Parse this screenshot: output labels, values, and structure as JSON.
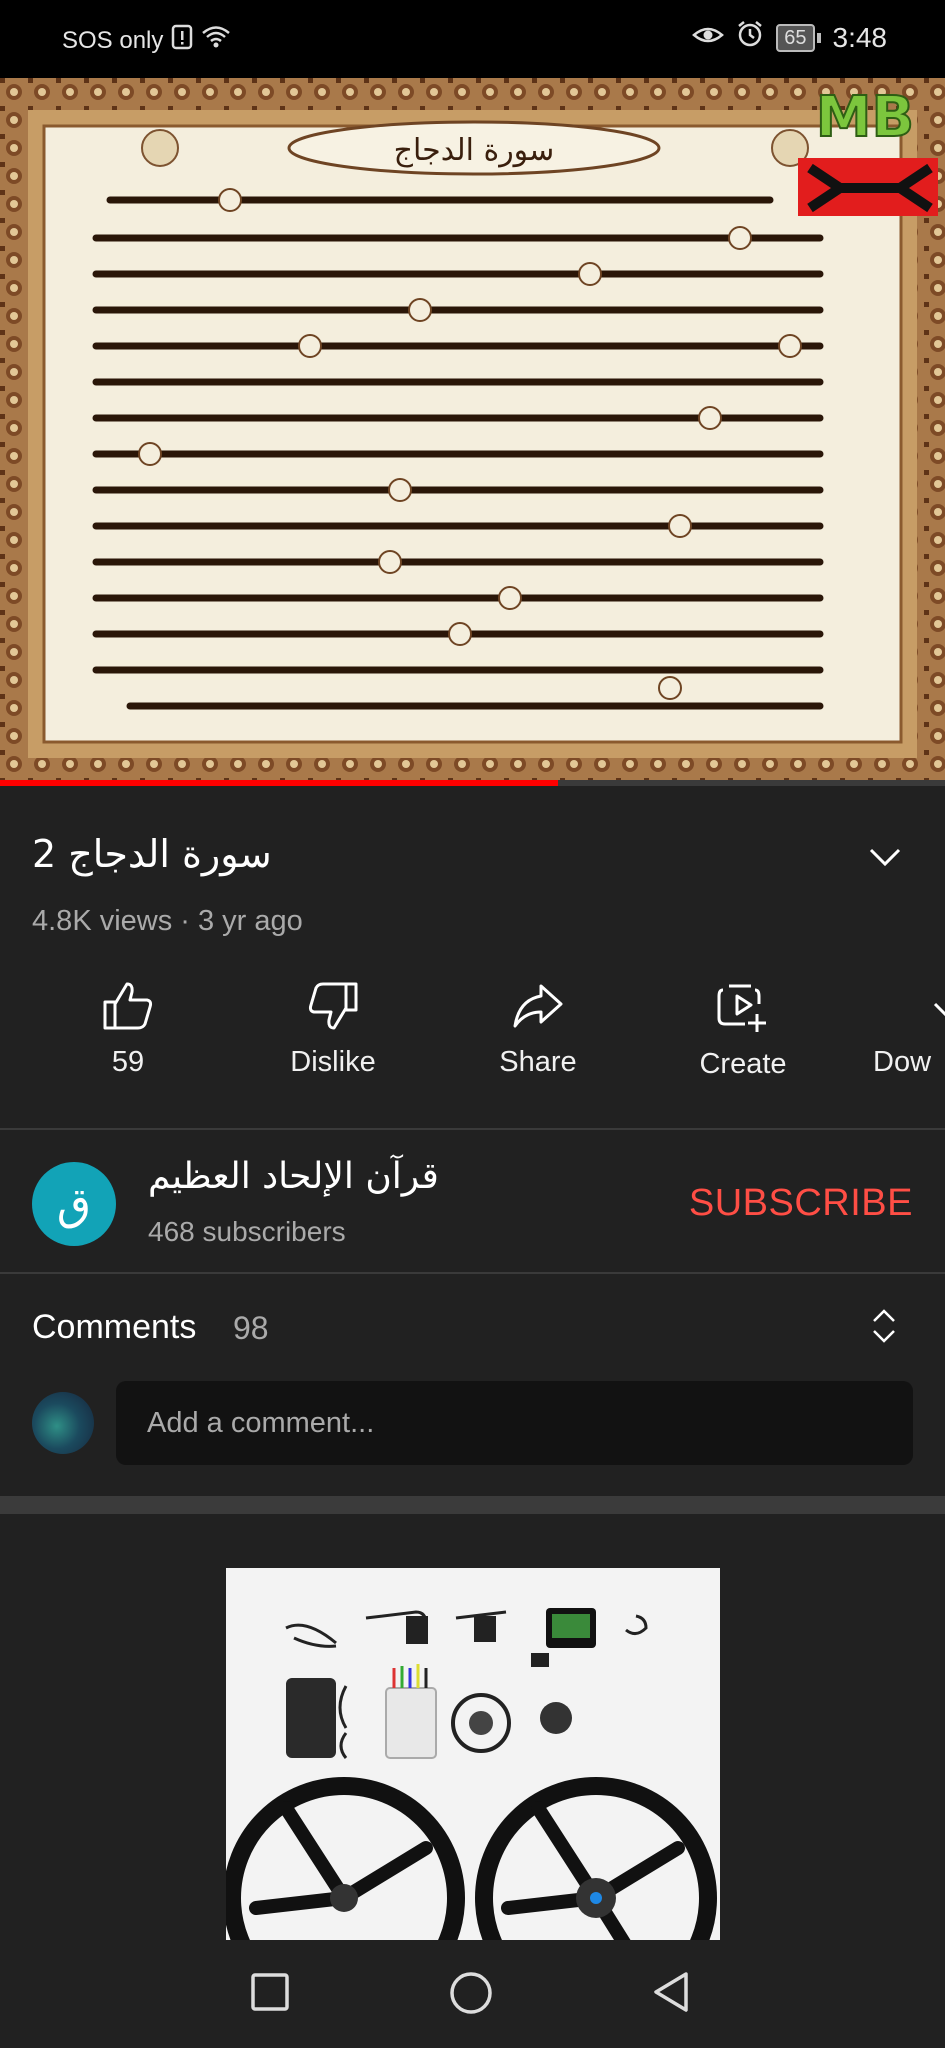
{
  "status_bar": {
    "carrier": "SOS only",
    "battery": "65",
    "time": "3:48"
  },
  "video": {
    "thumbnail_title": "سورة الدجاج",
    "progress": 0.59,
    "progress_color": "#ff0000"
  },
  "title": "سورة الدجاج 2",
  "meta": "4.8K views · 3 yr ago",
  "actions": [
    {
      "label": "59",
      "icon": "thumbs-up-icon"
    },
    {
      "label": "Dislike",
      "icon": "thumbs-down-icon"
    },
    {
      "label": "Share",
      "icon": "share-icon"
    },
    {
      "label": "Create",
      "icon": "create-icon"
    },
    {
      "label": "Dow",
      "icon": "download-icon"
    }
  ],
  "channel": {
    "avatar_letter": "ق",
    "name": "قرآن الإلحاد العظيم",
    "subscribers": "468 subscribers",
    "subscribe_label": "SUBSCRIBE",
    "accent": "#ff4e45"
  },
  "comments": {
    "title": "Comments",
    "count": "98",
    "placeholder": "Add a comment..."
  },
  "navbar": [
    "recents-icon",
    "home-icon",
    "back-icon"
  ]
}
